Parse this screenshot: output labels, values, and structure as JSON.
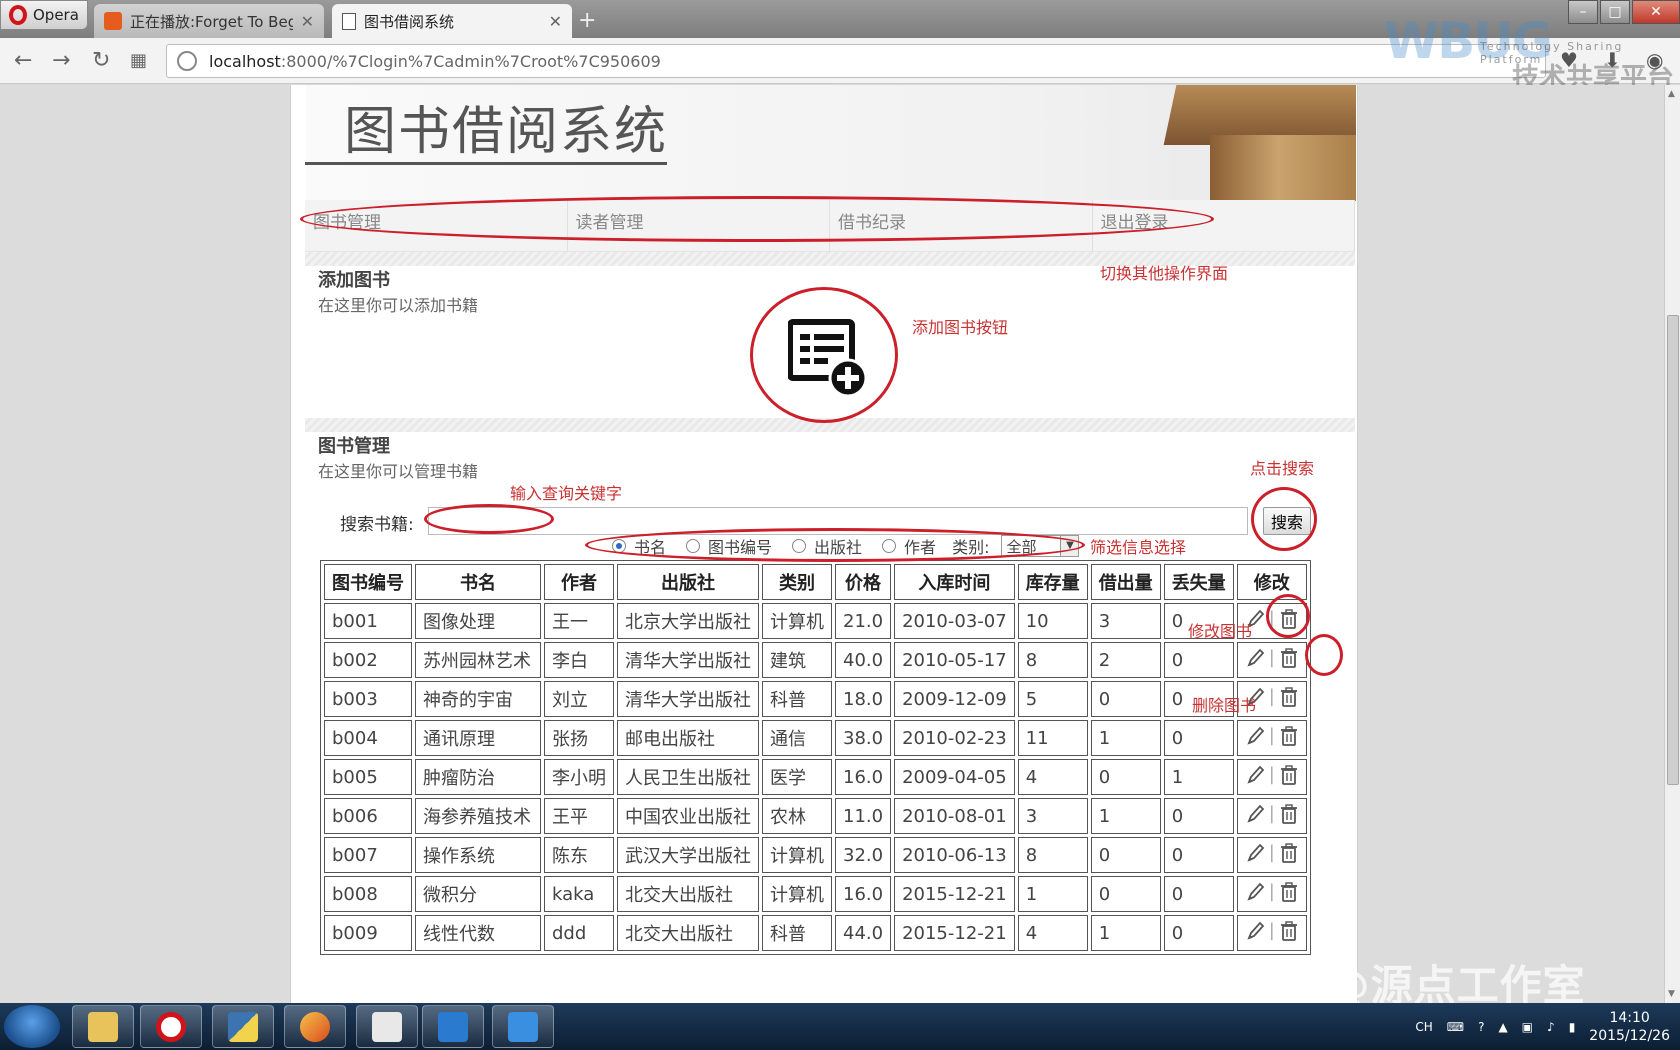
{
  "browser": {
    "opera_label": "Opera",
    "tabs": [
      {
        "label": "正在播放:Forget To Begin",
        "active": false
      },
      {
        "label": "图书借阅系统",
        "active": true
      }
    ],
    "new_tab_symbol": "+",
    "address": {
      "host": "localhost",
      "path": ":8000/%7Clogin%7Cadmin%7Croot%7C950609"
    }
  },
  "watermark": {
    "brand": "WBUG",
    "tagline": "Technology Sharing Platform",
    "cn": "技术共享平台",
    "bottom": "知乎 @源点工作室"
  },
  "header": {
    "title": "图书借阅系统"
  },
  "menu": {
    "items": [
      "图书管理",
      "读者管理",
      "借书纪录",
      "退出登录"
    ]
  },
  "add_section": {
    "title": "添加图书",
    "subtitle": "在这里你可以添加书籍"
  },
  "manage_section": {
    "title": "图书管理",
    "subtitle": "在这里你可以管理书籍"
  },
  "search": {
    "label": "搜索书籍:",
    "value": "",
    "button": "搜索",
    "radios": [
      "书名",
      "图书编号",
      "出版社",
      "作者"
    ],
    "selected_radio": "书名",
    "category_label": "类别:",
    "category_value": "全部"
  },
  "table": {
    "headers": [
      "图书编号",
      "书名",
      "作者",
      "出版社",
      "类别",
      "价格",
      "入库时间",
      "库存量",
      "借出量",
      "丢失量",
      "修改"
    ],
    "rows": [
      [
        "b001",
        "图像处理",
        "王一",
        "北京大学出版社",
        "计算机",
        "21.0",
        "2010-03-07",
        "10",
        "3",
        "0"
      ],
      [
        "b002",
        "苏州园林艺术",
        "李白",
        "清华大学出版社",
        "建筑",
        "40.0",
        "2010-05-17",
        "8",
        "2",
        "0"
      ],
      [
        "b003",
        "神奇的宇宙",
        "刘立",
        "清华大学出版社",
        "科普",
        "18.0",
        "2009-12-09",
        "5",
        "0",
        "0"
      ],
      [
        "b004",
        "通讯原理",
        "张扬",
        "邮电出版社",
        "通信",
        "38.0",
        "2010-02-23",
        "11",
        "1",
        "0"
      ],
      [
        "b005",
        "肿瘤防治",
        "李小明",
        "人民卫生出版社",
        "医学",
        "16.0",
        "2009-04-05",
        "4",
        "0",
        "1"
      ],
      [
        "b006",
        "海参养殖技术",
        "王平",
        "中国农业出版社",
        "农林",
        "11.0",
        "2010-08-01",
        "3",
        "1",
        "0"
      ],
      [
        "b007",
        "操作系统",
        "陈东",
        "武汉大学出版社",
        "计算机",
        "32.0",
        "2010-06-13",
        "8",
        "0",
        "0"
      ],
      [
        "b008",
        "微积分",
        "kaka",
        "北交大出版社",
        "计算机",
        "16.0",
        "2015-12-21",
        "1",
        "0",
        "0"
      ],
      [
        "b009",
        "线性代数",
        "ddd",
        "北交大出版社",
        "科普",
        "44.0",
        "2015-12-21",
        "4",
        "1",
        "0"
      ]
    ]
  },
  "annotations": {
    "switch_ui": "切换其他操作界面",
    "add_button": "添加图书按钮",
    "click_search": "点击搜索",
    "input_keyword": "输入查询关键字",
    "filter_select": "筛选信息选择",
    "edit_book": "修改图书",
    "delete_book": "删除图书"
  },
  "taskbar": {
    "lang": "CH",
    "time": "14:10",
    "date": "2015/12/26"
  },
  "colors": {
    "annotation": "#cc1f2a",
    "tab_active": "#f3f3f3"
  }
}
